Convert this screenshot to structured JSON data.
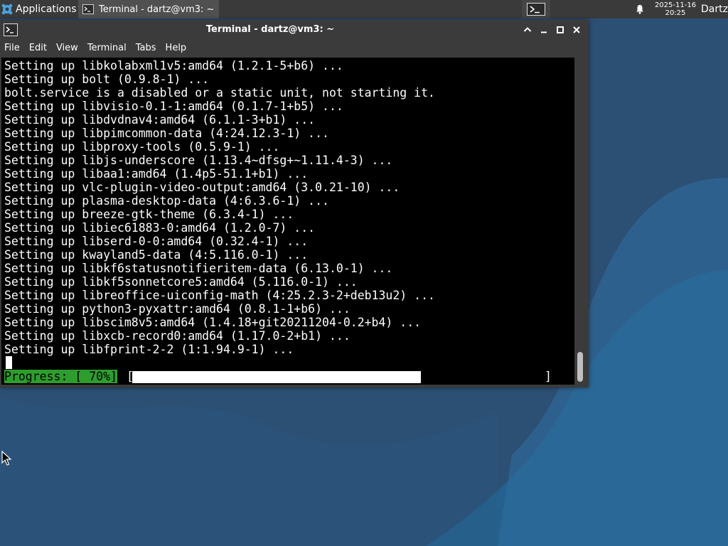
{
  "panel": {
    "applications_label": "Applications",
    "applications_sep": "☰",
    "task_label": "Terminal - dartz@vm3: ~",
    "clock_date": "2025-11-16",
    "clock_time": "20:25",
    "user": "Dartz"
  },
  "window": {
    "title": "Terminal - dartz@vm3: ~",
    "menu": [
      "File",
      "Edit",
      "View",
      "Terminal",
      "Tabs",
      "Help"
    ]
  },
  "terminal": {
    "lines": [
      "Setting up libkolabxml1v5:amd64 (1.2.1-5+b6) ...",
      "Setting up bolt (0.9.8-1) ...",
      "bolt.service is a disabled or a static unit, not starting it.",
      "Setting up libvisio-0.1-1:amd64 (0.1.7-1+b5) ...",
      "Setting up libdvdnav4:amd64 (6.1.1-3+b1) ...",
      "Setting up libpimcommon-data (4:24.12.3-1) ...",
      "Setting up libproxy-tools (0.5.9-1) ...",
      "Setting up libjs-underscore (1.13.4~dfsg+~1.11.4-3) ...",
      "Setting up libaa1:amd64 (1.4p5-51.1+b1) ...",
      "Setting up vlc-plugin-video-output:amd64 (3.0.21-10) ...",
      "Setting up plasma-desktop-data (4:6.3.6-1) ...",
      "Setting up breeze-gtk-theme (6.3.4-1) ...",
      "Setting up libiec61883-0:amd64 (1.2.0-7) ...",
      "Setting up libserd-0-0:amd64 (0.32.4-1) ...",
      "Setting up kwayland5-data (4:5.116.0-1) ...",
      "Setting up libkf6statusnotifieritem-data (6.13.0-1) ...",
      "Setting up libkf5sonnetcore5:amd64 (5.116.0-1) ...",
      "Setting up libreoffice-uiconfig-math (4:25.2.3-2+deb13u2) ...",
      "Setting up python3-pyxattr:amd64 (0.8.1-1+b6) ...",
      "Setting up libscim8v5:amd64 (1.4.18+git20211204-0.2+b4) ...",
      "Setting up libxcb-record0:amd64 (1.17.0-2+b1) ...",
      "Setting up libfprint-2-2 (1:1.94.9-1) ..."
    ],
    "progress_label": "Progress: [ 70%]",
    "progress_open": "[",
    "progress_close": "]",
    "progress_fraction": 0.7
  },
  "colors": {
    "progress_label_bg": "#2e9d2e",
    "terminal_bg": "#000000",
    "desktop_bg": "#2c4f74"
  },
  "icons": {
    "applications": "xfce-mouse-icon",
    "task": "terminal-icon",
    "workspace": "terminal-icon",
    "notifications": "bell-icon",
    "window": "terminal-icon"
  }
}
